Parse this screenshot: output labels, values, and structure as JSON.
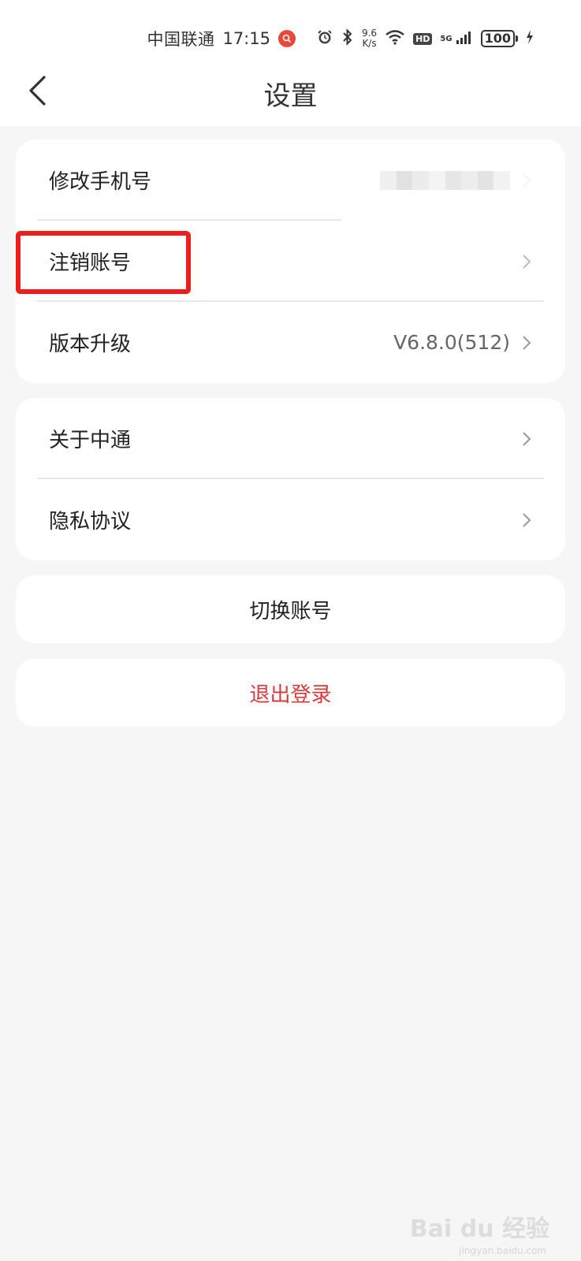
{
  "status_bar": {
    "carrier": "中国联通",
    "time": "17:15",
    "speed_value": "9.6",
    "speed_unit": "K/s",
    "hd": "HD",
    "network": "5G",
    "battery": "100"
  },
  "nav": {
    "title": "设置"
  },
  "settings_group_1": [
    {
      "label": "修改手机号",
      "value": ""
    },
    {
      "label": "注销账号",
      "value": ""
    },
    {
      "label": "版本升级",
      "value": "V6.8.0(512)"
    }
  ],
  "settings_group_2": [
    {
      "label": "关于中通"
    },
    {
      "label": "隐私协议"
    }
  ],
  "actions": {
    "switch_account": "切换账号",
    "logout": "退出登录"
  },
  "colors": {
    "logout_text": "#d83a3a",
    "highlight": "#ee1d1d",
    "page_bg": "#f6f6f6"
  },
  "watermark": {
    "text": "Bai du 经验",
    "sub": "jingyan.baidu.com"
  }
}
